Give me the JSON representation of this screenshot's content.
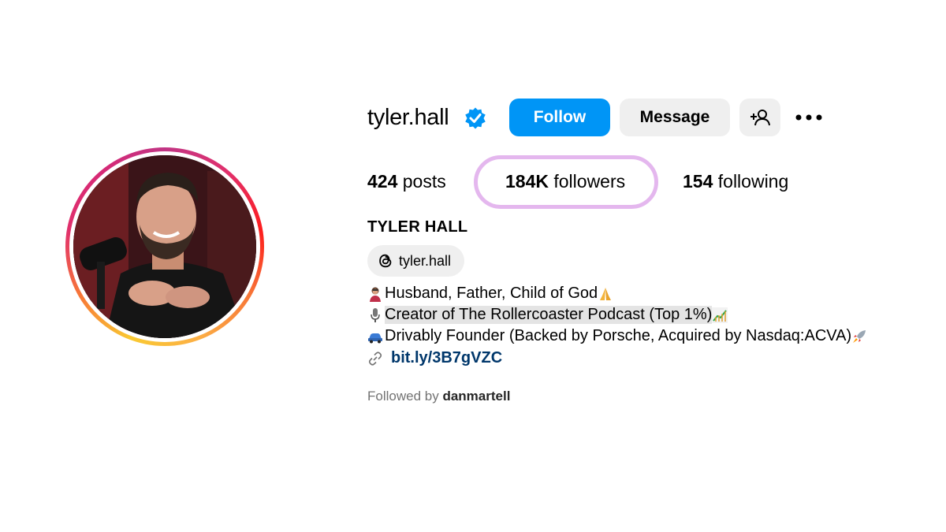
{
  "profile": {
    "username": "tyler.hall",
    "full_name": "TYLER HALL",
    "verified_icon": "verified-badge-icon",
    "avatar_icon": "profile-photo"
  },
  "actions": {
    "follow_label": "Follow",
    "message_label": "Message",
    "add_user_icon": "add-person-icon",
    "more_icon": "more-options-icon"
  },
  "stats": {
    "posts_count": "424",
    "posts_label": "posts",
    "followers_count": "184K",
    "followers_label": "followers",
    "following_count": "154",
    "following_label": "following"
  },
  "threads": {
    "handle": "tyler.hall",
    "icon": "threads-icon"
  },
  "bio": {
    "line1": "Husband, Father, Child of God",
    "line2": "Creator of The Rollercoaster Podcast (Top 1%)",
    "line3": "Drivably Founder (Backed by Porsche, Acquired by Nasdaq:ACVA)",
    "link": "bit.ly/3B7gVZC"
  },
  "followed_by": {
    "prefix": "Followed by",
    "name": "danmartell"
  },
  "colors": {
    "primary_button": "#0095f6",
    "secondary_button": "#efefef",
    "highlight": "#e4b7ee",
    "link": "#00376b",
    "muted": "#737373"
  }
}
